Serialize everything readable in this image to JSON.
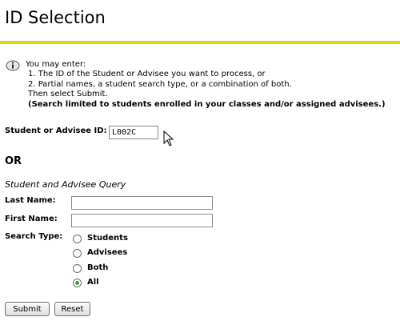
{
  "page": {
    "title": "ID Selection"
  },
  "info": {
    "icon": "info-icon",
    "lines": [
      "You may enter:",
      "1. The ID of the Student or Advisee you want to process, or",
      "2. Partial names, a student search type, or a combination of both.",
      "Then select Submit."
    ],
    "note": "(Search limited to students enrolled in your classes and/or assigned advisees.)"
  },
  "id_field": {
    "label": "Student or Advisee ID:",
    "value": "L002C"
  },
  "or_text": "OR",
  "query": {
    "title": "Student and Advisee Query",
    "last_name_label": "Last Name:",
    "first_name_label": "First Name:",
    "search_type_label": "Search Type:",
    "options": [
      "Students",
      "Advisees",
      "Both",
      "All"
    ],
    "selected": "All"
  },
  "buttons": {
    "submit": "Submit",
    "reset": "Reset"
  },
  "colors": {
    "title_rule": "#d9d600",
    "radio_selected": "#3aa63a"
  }
}
